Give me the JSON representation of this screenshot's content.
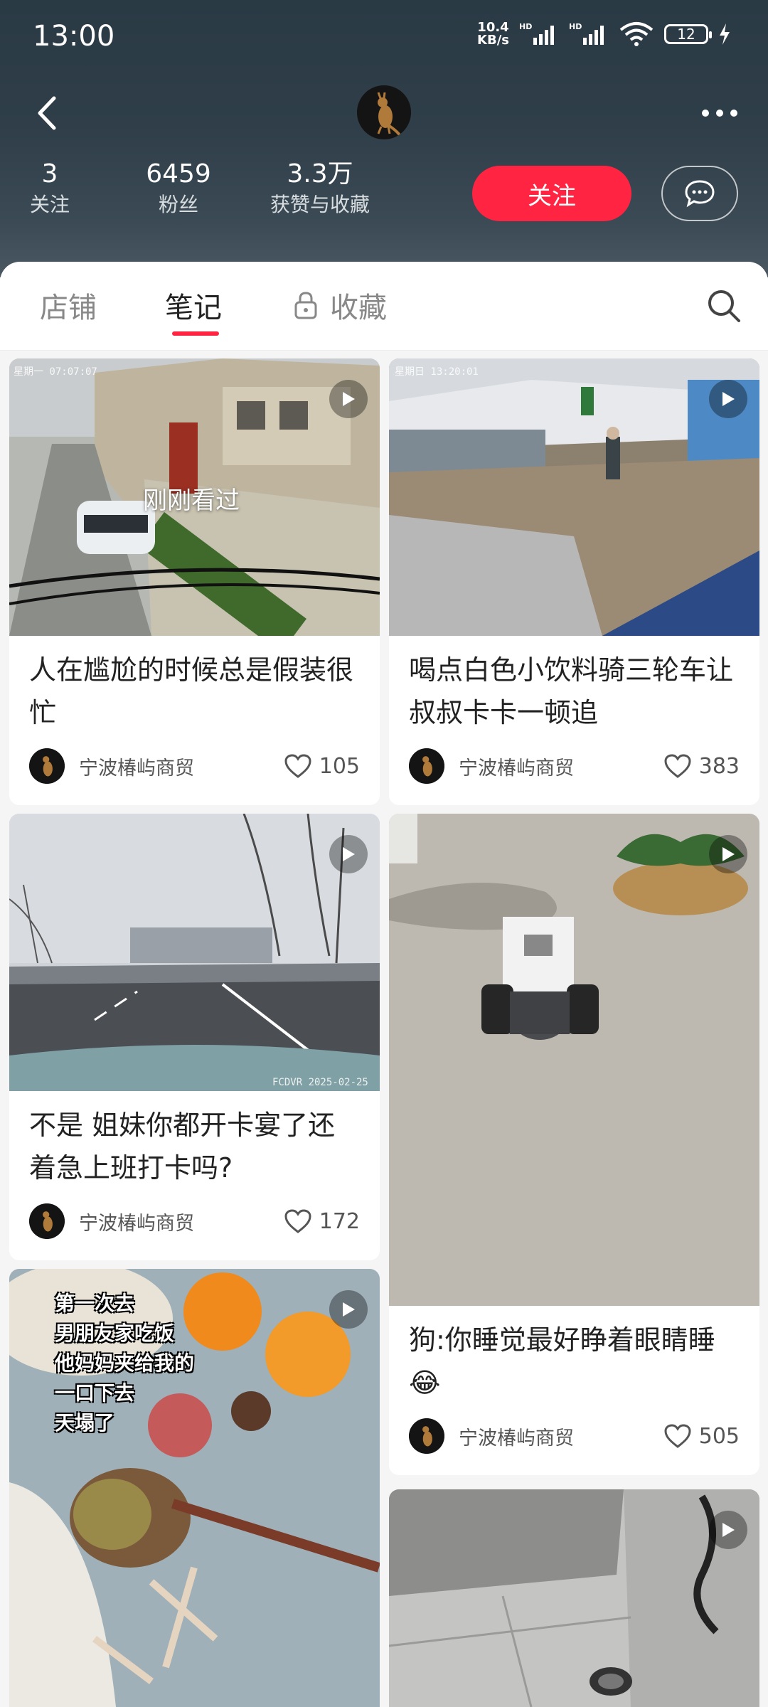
{
  "status": {
    "time": "13:00",
    "net_speed_value": "10.4",
    "net_speed_unit": "KB/s",
    "battery": "12"
  },
  "profile": {
    "stats": [
      {
        "value": "3",
        "label": "关注"
      },
      {
        "value": "6459",
        "label": "粉丝"
      },
      {
        "value": "3.3万",
        "label": "获赞与收藏"
      }
    ],
    "follow_label": "关注"
  },
  "tabs": {
    "shop": "店铺",
    "notes": "笔记",
    "favorites": "收藏"
  },
  "notes": [
    {
      "title": "人在尴尬的时候总是假装很忙",
      "author": "宁波椿屿商贸",
      "likes": "105",
      "overlay": "刚刚看过",
      "stamp": "星期一  07:07:07"
    },
    {
      "title": "喝点白色小饮料骑三轮车让叔叔卡卡一顿追",
      "author": "宁波椿屿商贸",
      "likes": "383",
      "stamp": "星期日  13:20:01"
    },
    {
      "title": "不是 姐妹你都开卡宴了还着急上班打卡吗?",
      "author": "宁波椿屿商贸",
      "likes": "172",
      "stamp": "FCDVR 2025-02-25"
    },
    {
      "title": "狗:你睡觉最好睁着眼睛睡😂",
      "author": "宁波椿屿商贸",
      "likes": "505"
    },
    {
      "overlay_lines": [
        "第一次去",
        "男朋友家吃饭",
        "他妈妈夹给我的",
        "一口下去",
        "天塌了"
      ]
    },
    {}
  ]
}
